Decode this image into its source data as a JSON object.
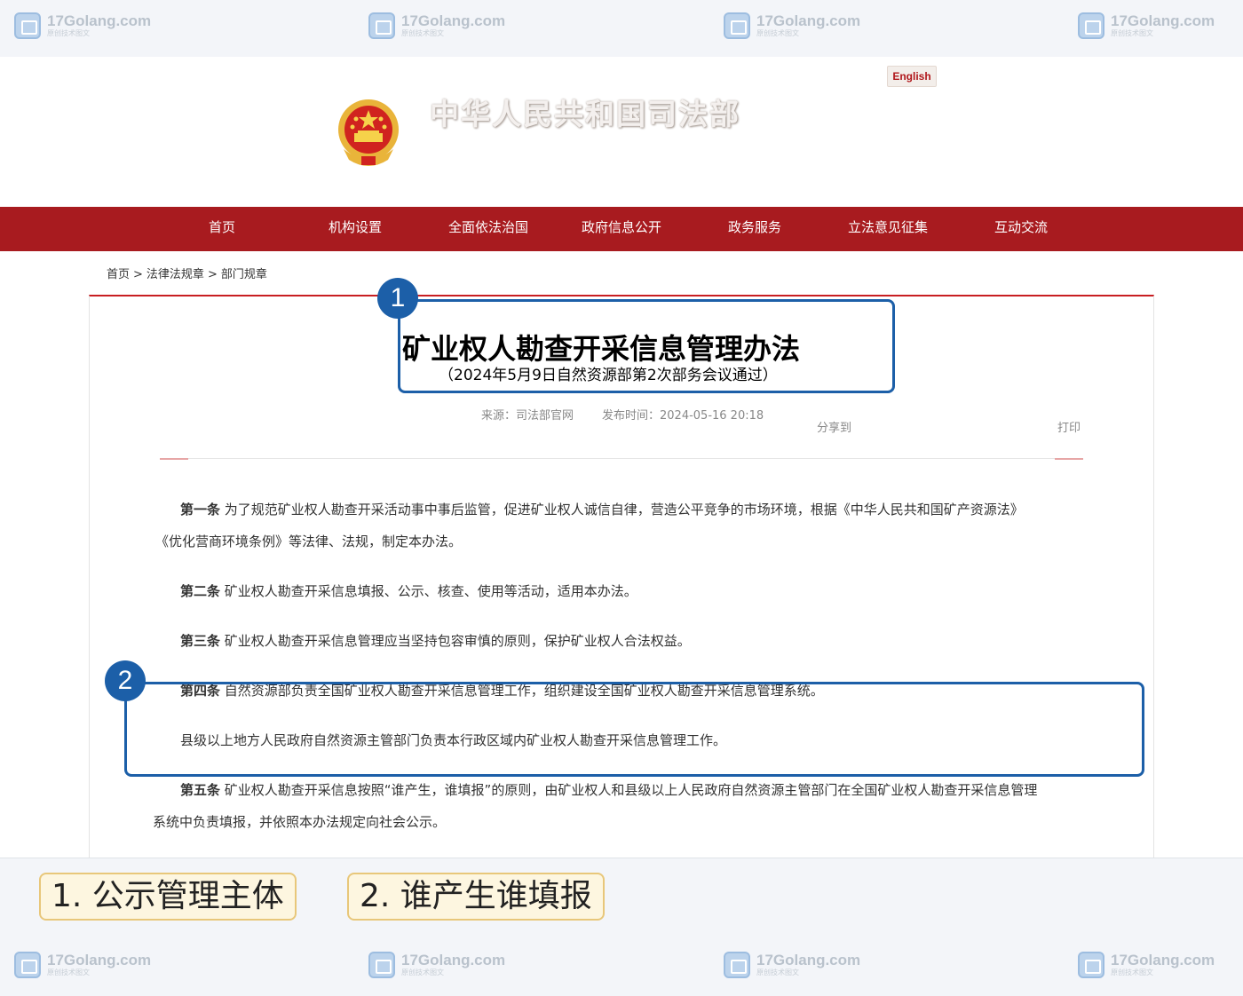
{
  "watermark": {
    "site": "17Golang.com",
    "sub": "原创技术图文"
  },
  "header": {
    "site_title": "中华人民共和国司法部",
    "english_label": "English"
  },
  "nav": [
    "首页",
    "机构设置",
    "全面依法治国",
    "政府信息公开",
    "政务服务",
    "立法意见征集",
    "互动交流"
  ],
  "breadcrumb": {
    "items": [
      "首页",
      "法律法规章",
      "部门规章"
    ],
    "sep": ">"
  },
  "article": {
    "title": "矿业权人勘查开采信息管理办法",
    "subtitle": "（2024年5月9日自然资源部第2次部务会议通过）",
    "source": "来源：司法部官网",
    "publish_time": "发布时间：2024-05-16 20:18",
    "share_label": "分享到",
    "print_label": "打印",
    "paragraphs": [
      {
        "heading": "第一条",
        "line1": " 为了规范矿业权人勘查开采活动事中事后监管，促进矿业权人诚信自律，营造公平竞争的市场环境，根据《中华人民共和国矿产资源法》",
        "line2": "《优化营商环境条例》等法律、法规，制定本办法。"
      },
      {
        "heading": "第二条",
        "line1": " 矿业权人勘查开采信息填报、公示、核查、使用等活动，适用本办法。"
      },
      {
        "heading": "第三条",
        "line1": " 矿业权人勘查开采信息管理应当坚持包容审慎的原则，保护矿业权人合法权益。"
      },
      {
        "heading": "第四条",
        "line1": " 自然资源部负责全国矿业权人勘查开采信息管理工作，组织建设全国矿业权人勘查开采信息管理系统。"
      },
      {
        "heading": "",
        "line1": "县级以上地方人民政府自然资源主管部门负责本行政区域内矿业权人勘查开采信息管理工作。"
      },
      {
        "heading": "第五条",
        "line1": " 矿业权人勘查开采信息按照“谁产生，谁填报”的原则，由矿业权人和县级以上人民政府自然资源主管部门在全国矿业权人勘查开采信息管理",
        "line2": "系统中负责填报，并依照本办法规定向社会公示。"
      }
    ]
  },
  "annotations": {
    "badges": [
      "1",
      "2"
    ],
    "tags": [
      "1. 公示管理主体",
      "2. 谁产生谁填报"
    ],
    "color": "#1c5fa8"
  },
  "colors": {
    "nav_bg": "#a81b1f",
    "accent_red": "#c81e22",
    "tag_bg": "#fdf6e0"
  }
}
